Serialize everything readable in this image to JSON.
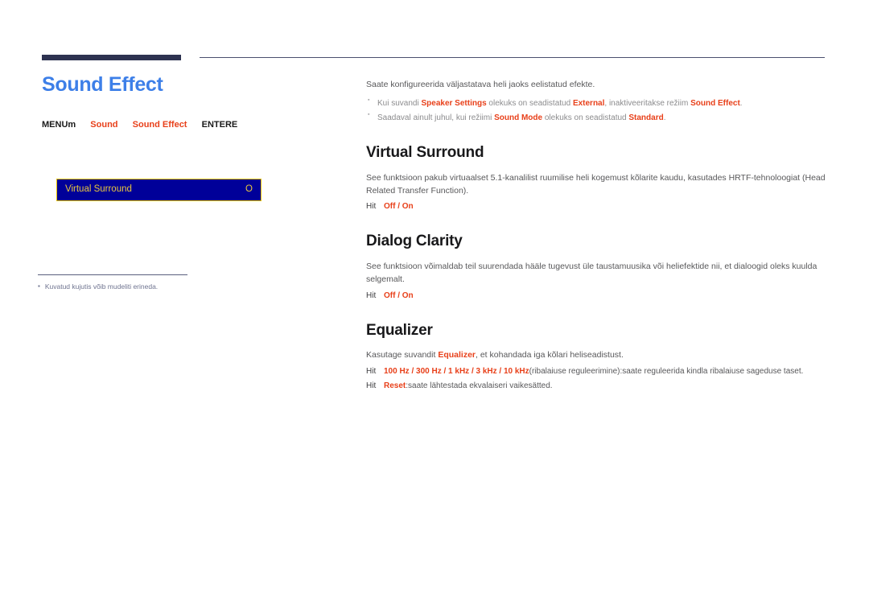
{
  "document": {
    "title": "Sound Effect",
    "breadcrumb": {
      "menu_label": "MENU",
      "menu_key": "m",
      "step1": "Sound",
      "step2": "Sound Effect",
      "enter_label": "ENTER",
      "enter_key": "E"
    }
  },
  "osd_menu": {
    "item_label": "Virtual Surround",
    "item_value": "O"
  },
  "footnote": {
    "bullet": "▪",
    "text": "Kuvatud kujutis võib mudeliti erineda."
  },
  "intro": {
    "text": "Saate konfigureerida väljastatava heli jaoks eelistatud efekte."
  },
  "intro_bullets": [
    {
      "pre": "Kui suvandi ",
      "hl1": "Speaker Settings",
      "mid1": " olekuks on seadistatud ",
      "hl2": "External",
      "mid2": ", inaktiveeritakse režiim ",
      "hl3": "Sound Effect",
      "post": "."
    },
    {
      "pre": "Saadaval ainult juhul, kui režiimi ",
      "hl1": "Sound Mode",
      "mid1": " olekuks on seadistatud ",
      "hl2": "Standard",
      "mid2": "",
      "hl3": "",
      "post": "."
    }
  ],
  "sections": [
    {
      "heading": "Virtual Surround",
      "body": "See funktsioon pakub virtuaalset 5.1-kanalilist ruumilise heli kogemust kõlarite kaudu, kasutades HRTF-tehnoloogiat (Head Related Transfer Function).",
      "hit_label": "Hit",
      "options": "Off / On"
    },
    {
      "heading": "Dialog Clarity",
      "body": "See funktsioon võimaldab teil suurendada hääle tugevust üle taustamuusika või heliefektide nii, et dialoogid oleks kuulda selgemalt.",
      "hit_label": "Hit",
      "options": "Off / On"
    },
    {
      "heading": "Equalizer",
      "body_pre": "Kasutage suvandit ",
      "body_hl": "Equalizer",
      "body_post": ", et kohandada iga kõlari heliseadistust.",
      "items": [
        {
          "hit_label": "Hit",
          "opt_name": "100 Hz / 300 Hz / 1 kHz / 3 kHz / 10 kHz",
          "desc": "(ribalaiuse reguleerimine):saate reguleerida kindla ribalaiuse sageduse taset."
        },
        {
          "hit_label": "Hit",
          "opt_name": "Reset",
          "desc": ":saate lähtestada ekvalaiseri vaikesätted."
        }
      ]
    }
  ]
}
